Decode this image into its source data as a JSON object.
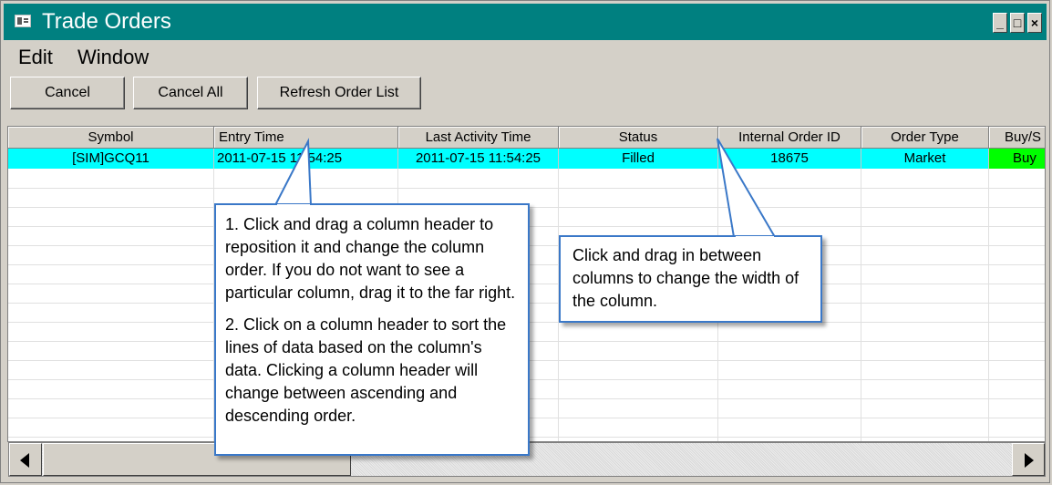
{
  "window": {
    "title": "Trade Orders",
    "controls": {
      "minimize": "_",
      "maximize": "□",
      "close": "×"
    }
  },
  "menu": [
    "Edit",
    "Window"
  ],
  "toolbar": {
    "cancel": "Cancel",
    "cancel_all": "Cancel All",
    "refresh": "Refresh Order List"
  },
  "grid": {
    "columns": [
      "Symbol",
      "Entry Time",
      "Last Activity Time",
      "Status",
      "Internal Order ID",
      "Order Type",
      "Buy/S"
    ],
    "rows": [
      [
        "[SIM]GCQ11",
        "2011-07-15 11:54:25",
        "2011-07-15 11:54:25",
        "Filled",
        "18675",
        "Market",
        "Buy"
      ]
    ],
    "selected_row_color": "#00ffff",
    "buy_color": "#00ff00"
  },
  "callouts": {
    "left": [
      "1. Click and drag a column header to reposition it and change the column order. If you do not want to see a particular column, drag it to the far right.",
      "2. Click on a column header to sort the lines of data based on the column's data. Clicking a column header will change between ascending and descending order."
    ],
    "right": "Click and drag in between columns to change the width of the column."
  }
}
